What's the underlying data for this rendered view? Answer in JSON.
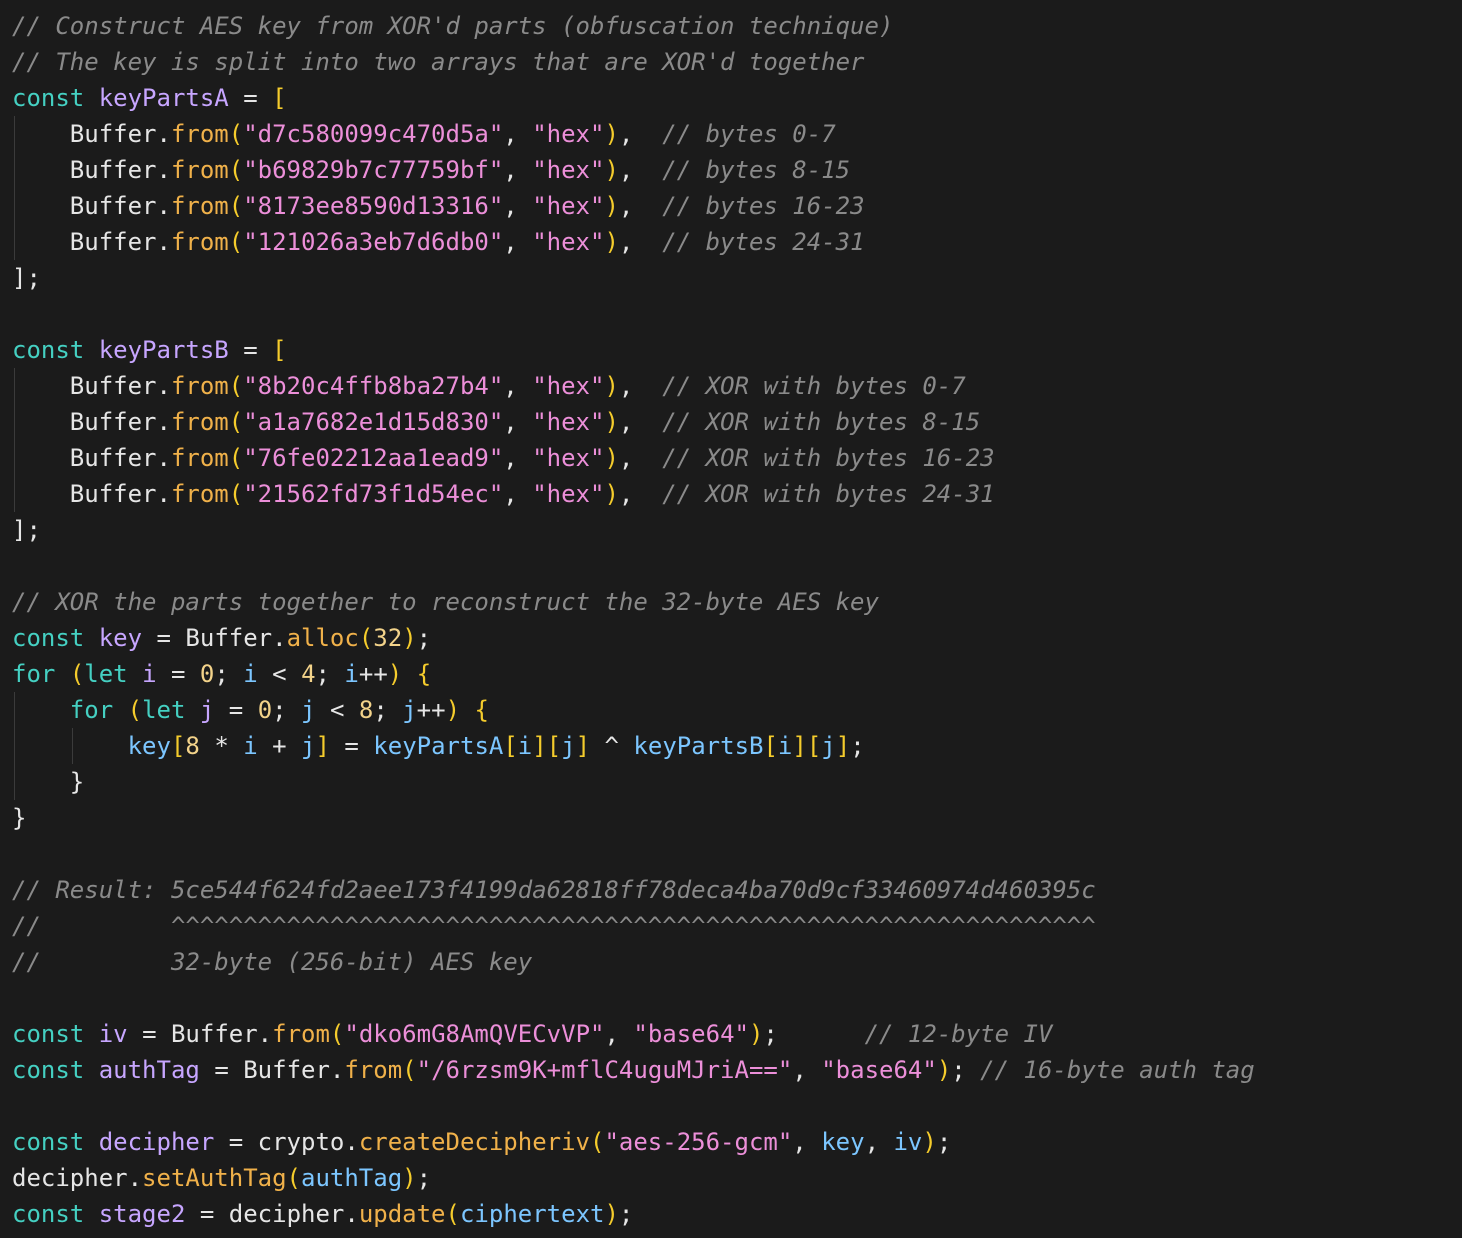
{
  "code_lines": [
    {
      "id": "c1",
      "text": "// Construct AES key from XOR'd parts (obfuscation technique)"
    },
    {
      "id": "c2",
      "text": "// The key is split into two arrays that are XOR'd together"
    },
    {
      "id": "a0",
      "text": "const keyPartsA = ["
    },
    {
      "id": "a1",
      "text": "    Buffer.from(\"d7c580099c470d5a\", \"hex\"),  // bytes 0-7"
    },
    {
      "id": "a2",
      "text": "    Buffer.from(\"b69829b7c77759bf\", \"hex\"),  // bytes 8-15"
    },
    {
      "id": "a3",
      "text": "    Buffer.from(\"8173ee8590d13316\", \"hex\"),  // bytes 16-23"
    },
    {
      "id": "a4",
      "text": "    Buffer.from(\"121026a3eb7d6db0\", \"hex\"),  // bytes 24-31"
    },
    {
      "id": "a5",
      "text": "];"
    },
    {
      "id": "b0",
      "text": "const keyPartsB = ["
    },
    {
      "id": "b1",
      "text": "    Buffer.from(\"8b20c4ffb8ba27b4\", \"hex\"),  // XOR with bytes 0-7"
    },
    {
      "id": "b2",
      "text": "    Buffer.from(\"a1a7682e1d15d830\", \"hex\"),  // XOR with bytes 8-15"
    },
    {
      "id": "b3",
      "text": "    Buffer.from(\"76fe02212aa1ead9\", \"hex\"),  // XOR with bytes 16-23"
    },
    {
      "id": "b4",
      "text": "    Buffer.from(\"21562fd73f1d54ec\", \"hex\"),  // XOR with bytes 24-31"
    },
    {
      "id": "b5",
      "text": "];"
    },
    {
      "id": "x0",
      "text": "// XOR the parts together to reconstruct the 32-byte AES key"
    },
    {
      "id": "x1",
      "text": "const key = Buffer.alloc(32);"
    },
    {
      "id": "x2",
      "text": "for (let i = 0; i < 4; i++) {"
    },
    {
      "id": "x3",
      "text": "    for (let j = 0; j < 8; j++) {"
    },
    {
      "id": "x4",
      "text": "        key[8 * i + j] = keyPartsA[i][j] ^ keyPartsB[i][j];"
    },
    {
      "id": "x5",
      "text": "    }"
    },
    {
      "id": "x6",
      "text": "}"
    },
    {
      "id": "r0",
      "text": "// Result: 5ce544f624fd2aee173f4199da62818ff78deca4ba70d9cf33460974d460395c"
    },
    {
      "id": "r1",
      "text": "//         ^^^^^^^^^^^^^^^^^^^^^^^^^^^^^^^^^^^^^^^^^^^^^^^^^^^^^^^^^^^^^^^^"
    },
    {
      "id": "r2",
      "text": "//         32-byte (256-bit) AES key"
    },
    {
      "id": "i0",
      "text": "const iv = Buffer.from(\"dko6mG8AmQVECvVP\", \"base64\");      // 12-byte IV"
    },
    {
      "id": "i1",
      "text": "const authTag = Buffer.from(\"/6rzsm9K+mflC4uguMJriA==\", \"base64\"); // 16-byte auth tag"
    },
    {
      "id": "d0",
      "text": "const decipher = crypto.createDecipheriv(\"aes-256-gcm\", key, iv);"
    },
    {
      "id": "d1",
      "text": "decipher.setAuthTag(authTag);"
    },
    {
      "id": "d2",
      "text": "const stage2 = decipher.update(ciphertext);"
    }
  ],
  "colors": {
    "background": "#1b1b1b",
    "keyword": "#45d0c2",
    "declaration": "#c7a6ff",
    "method": "#f0b14a",
    "string": "#ec8fd9",
    "number": "#f3d38a",
    "comment": "#8a8a8a",
    "bracket_1": "#f5cc2c",
    "bracket_2": "#d56fd8",
    "bracket_3": "#4aa8f0"
  }
}
